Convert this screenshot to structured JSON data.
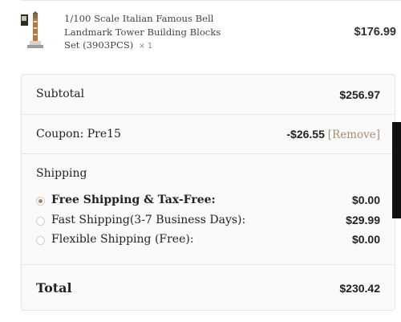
{
  "product": {
    "name": "1/100 Scale Italian Famous Bell Landmark Tower Building Blocks Set (3903PCS)",
    "quantity": "× 1",
    "price": "$176.99",
    "thumbnail_icon": "bell-tower-product-image"
  },
  "summary": {
    "subtotal_label": "Subtotal",
    "subtotal_value": "$256.97",
    "coupon_label": "Coupon: Pre15",
    "coupon_value": "-$26.55",
    "coupon_remove": "[Remove]",
    "shipping_label": "Shipping",
    "shipping_options": [
      {
        "label": "Free Shipping & Tax-Free:",
        "value": "$0.00",
        "selected": true
      },
      {
        "label": "Fast Shipping(3-7 Business Days):",
        "value": "$29.99",
        "selected": false
      },
      {
        "label": "Flexible Shipping (Free):",
        "value": "$0.00",
        "selected": false
      }
    ],
    "total_label": "Total",
    "total_value": "$230.42"
  },
  "colors": {
    "accent": "#a0826a",
    "remove_link": "#a78e70",
    "panel_bg": "#fafafa",
    "border": "#e5e5e5"
  }
}
